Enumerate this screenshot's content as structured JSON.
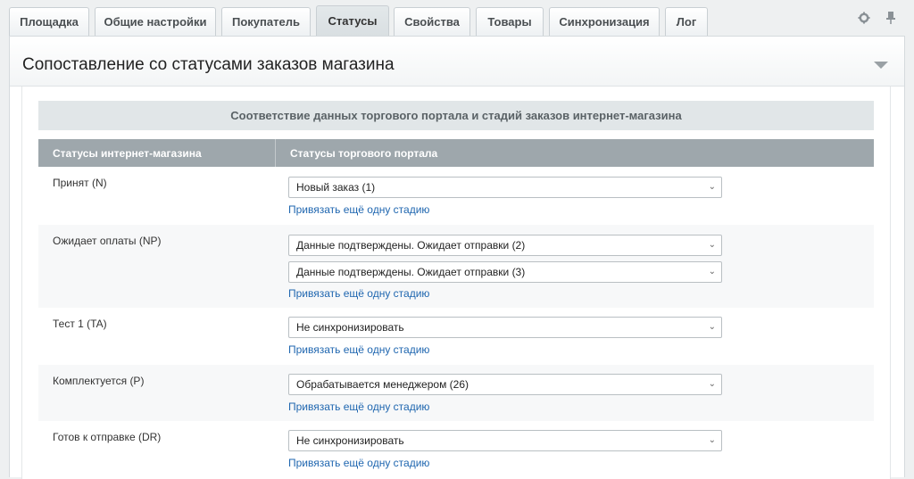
{
  "tabs": [
    {
      "label": "Площадка"
    },
    {
      "label": "Общие настройки"
    },
    {
      "label": "Покупатель"
    },
    {
      "label": "Статусы"
    },
    {
      "label": "Свойства"
    },
    {
      "label": "Товары"
    },
    {
      "label": "Синхронизация"
    },
    {
      "label": "Лог"
    }
  ],
  "active_tab": "Статусы",
  "section": {
    "title": "Сопоставление со статусами заказов магазина"
  },
  "table": {
    "caption": "Соответствие данных торгового портала и стадий заказов интернет-магазина",
    "col_shop": "Статусы интернет-магазина",
    "col_portal": "Статусы торгового портала",
    "link_label": "Привязать ещё одну стадию",
    "rows": [
      {
        "label": "Принят (N)",
        "selects": [
          "Новый заказ (1)"
        ]
      },
      {
        "label": "Ожидает оплаты (NP)",
        "selects": [
          "Данные подтверждены. Ожидает отправки (2)",
          "Данные подтверждены. Ожидает отправки (3)"
        ]
      },
      {
        "label": "Тест 1 (TA)",
        "selects": [
          "Не синхронизировать"
        ]
      },
      {
        "label": "Комплектуется (P)",
        "selects": [
          "Обрабатывается менеджером (26)"
        ]
      },
      {
        "label": "Готов к отправке (DR)",
        "selects": [
          "Не синхронизировать"
        ]
      }
    ]
  },
  "icons": {
    "settings": "gear-icon",
    "pin": "pin-icon",
    "collapse": "triangle-down-icon",
    "select_arrow": "chevron-down-icon"
  }
}
